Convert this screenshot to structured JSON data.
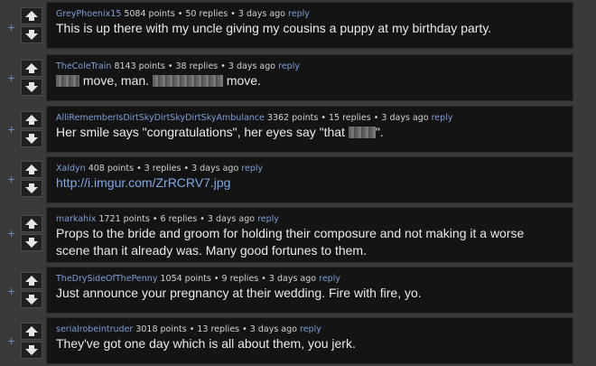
{
  "comments": [
    {
      "user": "GreyPhoenix15",
      "points": "5084 points",
      "replies": "50 replies",
      "age": "3 days ago",
      "reply": "reply",
      "text": "This is up there with my uncle giving my cousins a puppy at my birthday party."
    },
    {
      "user": "TheColeTrain",
      "points": "8143 points",
      "replies": "38 replies",
      "age": "3 days ago",
      "reply": "reply",
      "text_parts": [
        "move, man.",
        "move."
      ]
    },
    {
      "user": "AlliRememberIsDirtSkyDirtSkyDirtSkyAmbulance",
      "points": "3362 points",
      "replies": "15 replies",
      "age": "3 days ago",
      "reply": "reply",
      "text_parts": [
        "Her smile says \"congratulations\", her eyes say \"that",
        "\"."
      ]
    },
    {
      "user": "Xaldyn",
      "points": "408 points",
      "replies": "3 replies",
      "age": "3 days ago",
      "reply": "reply",
      "text": "http://i.imgur.com/ZrRCRV7.jpg"
    },
    {
      "user": "markahix",
      "points": "1721 points",
      "replies": "6 replies",
      "age": "3 days ago",
      "reply": "reply",
      "text": "Props to the bride and groom for holding their composure and not making it a worse scene than it already was. Many good fortunes to them."
    },
    {
      "user": "TheDrySideOfThePenny",
      "points": "1054 points",
      "replies": "9 replies",
      "age": "3 days ago",
      "reply": "reply",
      "text": "Just announce your pregnancy at their wedding. Fire with fire, yo."
    },
    {
      "user": "serialrobeintruder",
      "points": "3018 points",
      "replies": "13 replies",
      "age": "3 days ago",
      "reply": "reply",
      "text": "They've got one day which is all about them, you jerk."
    }
  ],
  "sep": "•",
  "expand_glyph": "+",
  "icons": {
    "up": "upvote-arrow-icon",
    "down": "downvote-arrow-icon"
  }
}
